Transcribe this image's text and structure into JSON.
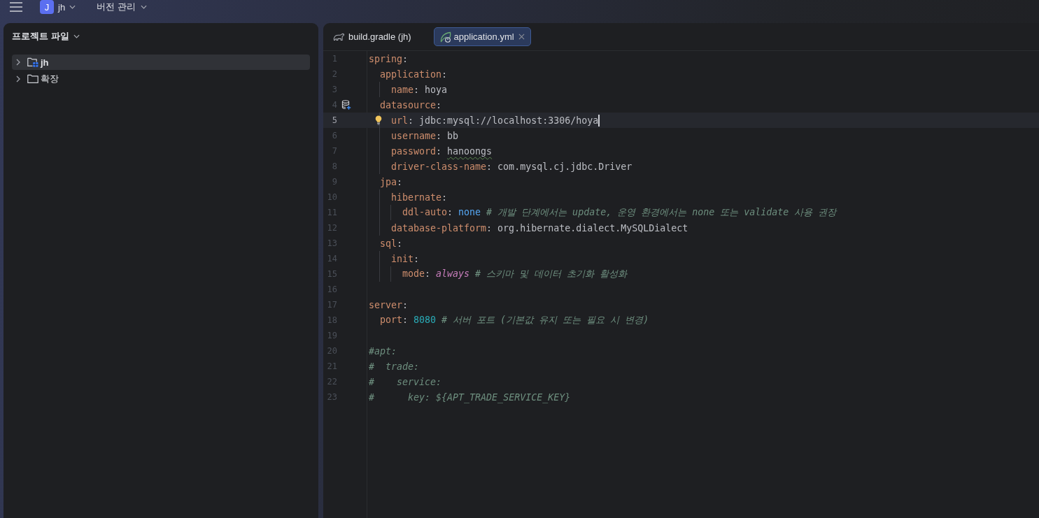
{
  "top_bar": {
    "project": {
      "initial": "J",
      "name": "jh"
    },
    "vcs_menu": "버전 관리"
  },
  "project_panel": {
    "title": "프로젝트 파일",
    "tree": [
      {
        "label": "jh",
        "kind": "module",
        "selected": true,
        "expanded": false
      },
      {
        "label": "확장",
        "kind": "folder",
        "selected": false,
        "expanded": false
      }
    ]
  },
  "editor": {
    "tabs": [
      {
        "label": "build.gradle (jh)",
        "kind": "gradle",
        "selected": false,
        "closable": false
      },
      {
        "label": "application.yml",
        "kind": "yaml",
        "selected": true,
        "closable": true
      }
    ],
    "lines": [
      {
        "number": "1",
        "current": false,
        "tokens": [
          {
            "kind": "key",
            "text": "spring"
          },
          {
            "kind": "punct",
            "text": ":"
          }
        ],
        "children": [
          {
            "number": "2",
            "current": false,
            "tokens": [
              {
                "kind": "key",
                "text": "application"
              },
              {
                "kind": "punct",
                "text": ":"
              }
            ],
            "children": [
              {
                "number": "3",
                "current": false,
                "tokens": [
                  {
                    "kind": "key",
                    "text": "name"
                  },
                  {
                    "kind": "punct",
                    "text": ": "
                  },
                  {
                    "kind": "value",
                    "text": "hoya"
                  }
                ]
              }
            ]
          },
          {
            "number": "4",
            "current": false,
            "gutter_icon": true,
            "tokens": [
              {
                "kind": "key",
                "text": "datasource"
              },
              {
                "kind": "punct",
                "text": ":"
              }
            ],
            "children": [
              {
                "number": "5",
                "current": true,
                "intention_bulb": true,
                "tokens": [
                  {
                    "kind": "key",
                    "text": "url"
                  },
                  {
                    "kind": "punct",
                    "text": ": "
                  },
                  {
                    "kind": "value",
                    "text": "jdbc:mysql://localhost:3306/hoya"
                  }
                ]
              },
              {
                "number": "6",
                "current": false,
                "tokens": [
                  {
                    "kind": "key",
                    "text": "username"
                  },
                  {
                    "kind": "punct",
                    "text": ": "
                  },
                  {
                    "kind": "value",
                    "text": "bb"
                  }
                ]
              },
              {
                "number": "7",
                "current": false,
                "tokens": [
                  {
                    "kind": "key",
                    "text": "password"
                  },
                  {
                    "kind": "punct",
                    "text": ": "
                  },
                  {
                    "kind": "value",
                    "text": "hanoongs",
                    "typo": true
                  }
                ]
              },
              {
                "number": "8",
                "current": false,
                "tokens": [
                  {
                    "kind": "key",
                    "text": "driver-class-name"
                  },
                  {
                    "kind": "punct",
                    "text": ": "
                  },
                  {
                    "kind": "value",
                    "text": "com.mysql.cj.jdbc.Driver"
                  }
                ]
              }
            ]
          },
          {
            "number": "9",
            "current": false,
            "tokens": [
              {
                "kind": "key",
                "text": "jpa"
              },
              {
                "kind": "punct",
                "text": ":"
              }
            ],
            "children": [
              {
                "number": "10",
                "current": false,
                "tokens": [
                  {
                    "kind": "key",
                    "text": "hibernate"
                  },
                  {
                    "kind": "punct",
                    "text": ":"
                  }
                ],
                "children": [
                  {
                    "number": "11",
                    "current": false,
                    "tokens": [
                      {
                        "kind": "key",
                        "text": "ddl-auto"
                      },
                      {
                        "kind": "punct",
                        "text": ": "
                      },
                      {
                        "kind": "constant",
                        "text": "none"
                      },
                      {
                        "kind": "comment",
                        "text": " # 개발 단계에서는 update, 운영 환경에서는 none 또는 validate 사용 권장"
                      }
                    ]
                  }
                ]
              },
              {
                "number": "12",
                "current": false,
                "tokens": [
                  {
                    "kind": "key",
                    "text": "database-platform"
                  },
                  {
                    "kind": "punct",
                    "text": ": "
                  },
                  {
                    "kind": "value",
                    "text": "org.hibernate.dialect.MySQLDialect"
                  }
                ]
              }
            ]
          },
          {
            "number": "13",
            "current": false,
            "tokens": [
              {
                "kind": "key",
                "text": "sql"
              },
              {
                "kind": "punct",
                "text": ":"
              }
            ],
            "children": [
              {
                "number": "14",
                "current": false,
                "tokens": [
                  {
                    "kind": "key",
                    "text": "init"
                  },
                  {
                    "kind": "punct",
                    "text": ":"
                  }
                ],
                "children": [
                  {
                    "number": "15",
                    "current": false,
                    "tokens": [
                      {
                        "kind": "key",
                        "text": "mode"
                      },
                      {
                        "kind": "punct",
                        "text": ": "
                      },
                      {
                        "kind": "enum",
                        "text": "always"
                      },
                      {
                        "kind": "comment",
                        "text": " # 스키마 및 데이터 초기화 활성화"
                      }
                    ]
                  }
                ]
              }
            ]
          }
        ]
      },
      {
        "number": "16",
        "current": false
      },
      {
        "number": "17",
        "current": false,
        "tokens": [
          {
            "kind": "key",
            "text": "server"
          },
          {
            "kind": "punct",
            "text": ":"
          }
        ],
        "children": [
          {
            "number": "18",
            "current": false,
            "tokens": [
              {
                "kind": "key",
                "text": "port"
              },
              {
                "kind": "punct",
                "text": ": "
              },
              {
                "kind": "number",
                "text": "8080"
              },
              {
                "kind": "comment",
                "text": " # 서버 포트 (기본값 유지 또는 필요 시 변경)"
              }
            ]
          }
        ]
      },
      {
        "number": "19",
        "current": false
      },
      {
        "number": "20",
        "current": false,
        "tokens": [
          {
            "kind": "comment",
            "text": "#apt:"
          }
        ]
      },
      {
        "number": "21",
        "current": false,
        "tokens": [
          {
            "kind": "comment",
            "text": "#  trade:"
          }
        ]
      },
      {
        "number": "22",
        "current": false,
        "tokens": [
          {
            "kind": "comment",
            "text": "#    service:"
          }
        ]
      },
      {
        "number": "23",
        "current": false,
        "tokens": [
          {
            "kind": "comment",
            "text": "#      key: ${APT_TRADE_SERVICE_KEY}"
          }
        ]
      }
    ]
  }
}
